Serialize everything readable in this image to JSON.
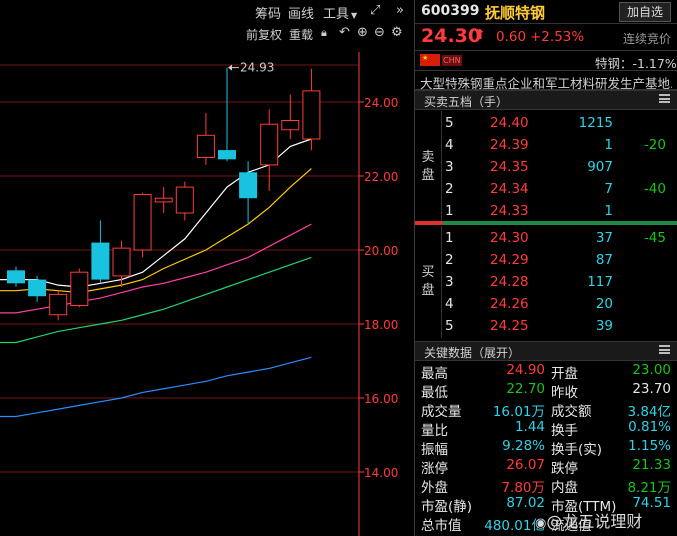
{
  "toolbar": {
    "chips_label": "筹码",
    "draw_label": "画线",
    "tools_label": "工具",
    "adjust_label": "前复权",
    "overlay_label": "重载"
  },
  "chart_data": {
    "type": "candlestick",
    "y_axis_ticks": [
      "24.00",
      "22.00",
      "20.00",
      "18.00",
      "16.00",
      "14.00"
    ],
    "y_ticks_values": [
      24,
      22,
      20,
      18,
      16,
      14
    ],
    "ylim": [
      13.0,
      25.5
    ],
    "max_annotation": "24.93",
    "candles": [
      {
        "o": 19.45,
        "c": 19.1,
        "h": 19.55,
        "l": 19.0
      },
      {
        "o": 19.2,
        "c": 18.75,
        "h": 19.3,
        "l": 18.6
      },
      {
        "o": 18.25,
        "c": 18.8,
        "h": 18.9,
        "l": 18.1
      },
      {
        "o": 18.5,
        "c": 19.4,
        "h": 19.5,
        "l": 18.45
      },
      {
        "o": 20.2,
        "c": 19.2,
        "h": 20.8,
        "l": 19.1
      },
      {
        "o": 19.3,
        "c": 20.05,
        "h": 20.25,
        "l": 19.0
      },
      {
        "o": 20.0,
        "c": 21.5,
        "h": 21.55,
        "l": 19.8
      },
      {
        "o": 21.3,
        "c": 21.4,
        "h": 21.7,
        "l": 21.0
      },
      {
        "o": 21.0,
        "c": 21.7,
        "h": 21.85,
        "l": 20.8
      },
      {
        "o": 22.5,
        "c": 23.1,
        "h": 23.7,
        "l": 22.3
      },
      {
        "o": 22.7,
        "c": 22.45,
        "h": 24.93,
        "l": 22.4
      },
      {
        "o": 22.1,
        "c": 21.4,
        "h": 22.4,
        "l": 20.7
      },
      {
        "o": 22.3,
        "c": 23.4,
        "h": 23.8,
        "l": 21.6
      },
      {
        "o": 23.25,
        "c": 23.5,
        "h": 24.2,
        "l": 23.0
      },
      {
        "o": 23.0,
        "c": 24.3,
        "h": 24.9,
        "l": 22.7
      }
    ],
    "ma5": [
      19.2,
      19.2,
      19.05,
      19.0,
      19.1,
      19.2,
      19.4,
      19.85,
      20.3,
      21.0,
      21.7,
      22.1,
      22.3,
      22.8,
      23.0
    ],
    "ma10": [
      18.9,
      18.95,
      18.9,
      18.85,
      18.95,
      19.05,
      19.2,
      19.5,
      19.75,
      20.0,
      20.35,
      20.7,
      21.15,
      21.7,
      22.2
    ],
    "ma20": [
      18.3,
      18.4,
      18.5,
      18.6,
      18.7,
      18.85,
      19.0,
      19.1,
      19.25,
      19.4,
      19.6,
      19.8,
      20.1,
      20.4,
      20.7
    ],
    "ma30": [
      17.5,
      17.65,
      17.8,
      17.9,
      18.0,
      18.1,
      18.25,
      18.4,
      18.6,
      18.8,
      19.0,
      19.2,
      19.4,
      19.6,
      19.8
    ],
    "ma60": [
      15.5,
      15.6,
      15.7,
      15.8,
      15.9,
      16.0,
      16.15,
      16.25,
      16.35,
      16.45,
      16.6,
      16.7,
      16.8,
      16.95,
      17.1
    ],
    "colors": {
      "up": "#ff3b3b",
      "down": "#19c3e0",
      "ma5": "#ffffff",
      "ma10": "#ffcc00",
      "ma20": "#ff3ea5",
      "ma30": "#22d36a",
      "ma60": "#2a8cff",
      "grid": "#7a1414",
      "axis": "#ff3b3b"
    }
  },
  "quote": {
    "code": "600399",
    "name": "抚顺特钢",
    "add_watch_label": "加自选",
    "price": "24.30",
    "change": "0.60",
    "change_pct": "+2.53%",
    "auction_label": "连续竞价",
    "flag_label": "CHN",
    "sector": "特钢：-1.17%",
    "concept": "大型特殊钢重点企业和军工材料研发生产基地..."
  },
  "orderbook": {
    "title": "买卖五档（手）",
    "sell_label": "卖盘",
    "buy_label": "买盘",
    "asks": [
      {
        "level": "5",
        "price": "24.40",
        "vol": "1215",
        "delta": ""
      },
      {
        "level": "4",
        "price": "24.39",
        "vol": "1",
        "delta": "-20"
      },
      {
        "level": "3",
        "price": "24.35",
        "vol": "907",
        "delta": ""
      },
      {
        "level": "2",
        "price": "24.34",
        "vol": "7",
        "delta": "-40"
      },
      {
        "level": "1",
        "price": "24.33",
        "vol": "1",
        "delta": ""
      }
    ],
    "bids": [
      {
        "level": "1",
        "price": "24.30",
        "vol": "37",
        "delta": "-45"
      },
      {
        "level": "2",
        "price": "24.29",
        "vol": "87",
        "delta": ""
      },
      {
        "level": "3",
        "price": "24.28",
        "vol": "117",
        "delta": ""
      },
      {
        "level": "4",
        "price": "24.26",
        "vol": "20",
        "delta": ""
      },
      {
        "level": "5",
        "price": "24.25",
        "vol": "39",
        "delta": ""
      }
    ],
    "buy_ratio": 0.98
  },
  "keydata": {
    "title": "关键数据（展开）",
    "rows": [
      {
        "l1": "最高",
        "v1": "24.90",
        "c1": "red",
        "l2": "开盘",
        "v2": "23.00",
        "c2": "green"
      },
      {
        "l1": "最低",
        "v1": "22.70",
        "c1": "green",
        "l2": "昨收",
        "v2": "23.70",
        "c2": "white"
      },
      {
        "l1": "成交量",
        "v1": "16.01万",
        "c1": "cyan",
        "l2": "成交额",
        "v2": "3.84亿",
        "c2": "cyan"
      },
      {
        "l1": "量比",
        "v1": "1.44",
        "c1": "cyan",
        "l2": "换手",
        "v2": "0.81%",
        "c2": "cyan"
      },
      {
        "l1": "振幅",
        "v1": "9.28%",
        "c1": "cyan",
        "l2": "换手(实)",
        "v2": "1.15%",
        "c2": "cyan"
      },
      {
        "l1": "涨停",
        "v1": "26.07",
        "c1": "red",
        "l2": "跌停",
        "v2": "21.33",
        "c2": "green"
      },
      {
        "l1": "外盘",
        "v1": "7.80万",
        "c1": "red",
        "l2": "内盘",
        "v2": "8.21万",
        "c2": "green"
      },
      {
        "l1": "市盈(静)",
        "v1": "87.02",
        "c1": "cyan",
        "l2": "市盈(TTM)",
        "v2": "74.51",
        "c2": "cyan"
      },
      {
        "l1": "总市值",
        "v1": "480.01亿",
        "c1": "cyan",
        "l2": "流通值",
        "v2": "",
        "c2": "cyan"
      }
    ]
  },
  "watermark": "@龙五说理财"
}
